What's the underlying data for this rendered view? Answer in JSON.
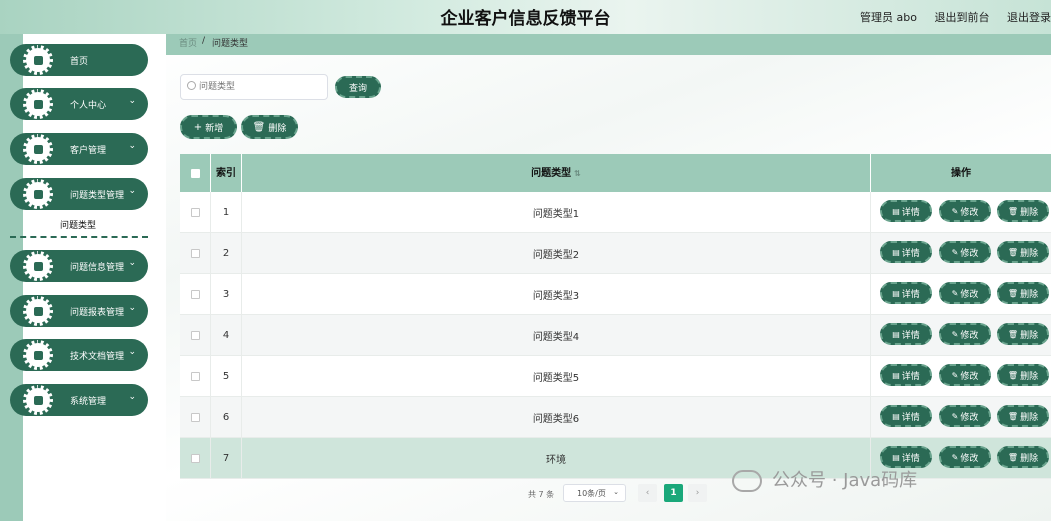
{
  "header": {
    "title": "企业客户信息反馈平台",
    "user": "管理员 abo",
    "back_link": "退出到前台",
    "logout": "退出登录"
  },
  "sidebar": {
    "items": [
      {
        "label": "首页",
        "icon": "home-icon",
        "chevron": ""
      },
      {
        "label": "个人中心",
        "icon": "user-icon",
        "chevron": "⌄"
      },
      {
        "label": "客户管理",
        "icon": "monitor-icon",
        "chevron": "⌄"
      },
      {
        "label": "问题类型管理",
        "icon": "user-icon",
        "chevron": "⌄"
      },
      {
        "label": "问题信息管理",
        "icon": "chart-icon",
        "chevron": "⌄"
      },
      {
        "label": "问题报表管理",
        "icon": "message-icon",
        "chevron": "⌄"
      },
      {
        "label": "技术文档管理",
        "icon": "ticket-icon",
        "chevron": "⌄"
      },
      {
        "label": "系统管理",
        "icon": "grid-icon",
        "chevron": "⌄"
      }
    ],
    "sub_item": "问题类型"
  },
  "breadcrumb": {
    "home": "首页",
    "sep": "/",
    "current": "问题类型"
  },
  "search": {
    "placeholder": "问题类型",
    "query_button": "查询"
  },
  "toolbar": {
    "add_label": "新增",
    "add_glyph": "+",
    "delete_label": "删除",
    "delete_glyph": "🗑"
  },
  "table": {
    "headers": {
      "index": "索引",
      "type": "问题类型",
      "ops": "操作",
      "sort_glyph": "⇅"
    },
    "rows": [
      {
        "index": "1",
        "type": "问题类型1"
      },
      {
        "index": "2",
        "type": "问题类型2"
      },
      {
        "index": "3",
        "type": "问题类型3"
      },
      {
        "index": "4",
        "type": "问题类型4"
      },
      {
        "index": "5",
        "type": "问题类型5"
      },
      {
        "index": "6",
        "type": "问题类型6"
      },
      {
        "index": "7",
        "type": "环境"
      }
    ],
    "ops": {
      "detail": "详情",
      "edit": "修改",
      "delete": "删除",
      "detail_glyph": "▤",
      "edit_glyph": "✎",
      "delete_glyph": "🗑"
    }
  },
  "pagination": {
    "total": "共 7 条",
    "page_size": "10条/页",
    "current": "1",
    "prev": "‹",
    "next": "›",
    "dropdown": "⌄"
  },
  "watermark": "公众号 · Java码库",
  "colors": {
    "primary": "#2b6a55",
    "header_bar": "#9ccab8",
    "pager_active": "#1aa87a"
  }
}
